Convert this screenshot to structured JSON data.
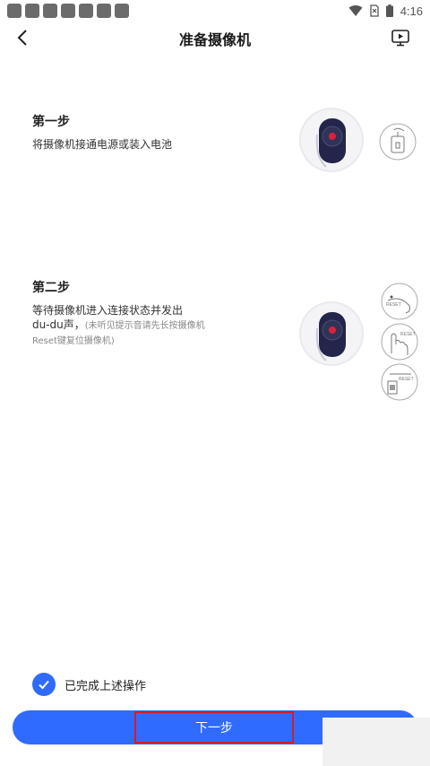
{
  "status_bar": {
    "time": "4:16",
    "notification_count": 7
  },
  "header": {
    "title": "准备摄像机",
    "back_icon": "chevron-left-icon",
    "video_icon": "play-tutorial-icon"
  },
  "steps": [
    {
      "title": "第一步",
      "description": "将摄像机接通电源或装入电池"
    },
    {
      "title": "第二步",
      "description_line1": "等待摄像机进入连接状态并发出",
      "description_line2": "du-du声，",
      "hint": "(未听见提示音请先长按摄像机Reset键复位摄像机)"
    }
  ],
  "mini_labels": {
    "reset": "RESET"
  },
  "confirm": {
    "label": "已完成上述操作",
    "checked": true
  },
  "footer": {
    "next_label": "下一步"
  },
  "colors": {
    "accent": "#2f6bff",
    "highlight_border": "#d01c2c",
    "camera_body": "#23264a",
    "camera_light": "#d9213a"
  }
}
